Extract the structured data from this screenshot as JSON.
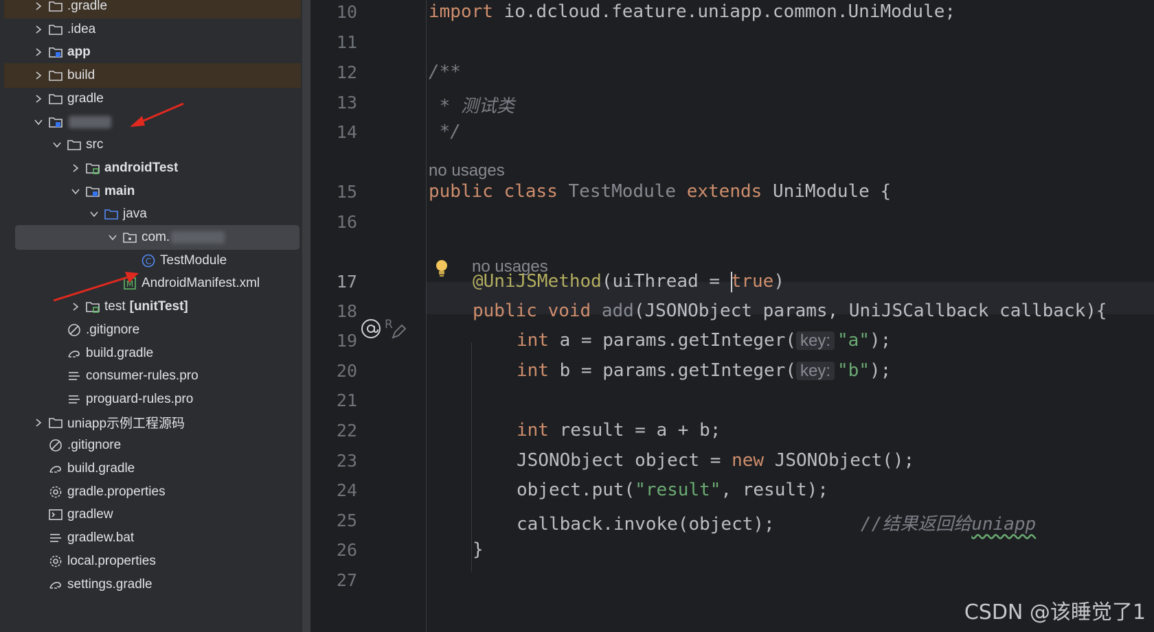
{
  "tree": {
    "items": [
      {
        "label": ".gradle",
        "icon": "folder-icon",
        "expand": "collapsed",
        "style": "excluded"
      },
      {
        "label": ".idea",
        "icon": "folder-icon",
        "expand": "collapsed"
      },
      {
        "label": "app",
        "icon": "module-folder-icon",
        "expand": "collapsed",
        "bold": true
      },
      {
        "label": "build",
        "icon": "folder-icon",
        "expand": "collapsed",
        "style": "excluded"
      },
      {
        "label": "gradle",
        "icon": "folder-icon",
        "expand": "collapsed"
      },
      {
        "label": "",
        "icon": "module-folder-icon",
        "expand": "expanded",
        "redacted": true
      },
      {
        "label": "src",
        "icon": "folder-icon",
        "expand": "expanded"
      },
      {
        "label": "androidTest",
        "icon": "test-folder-icon",
        "expand": "collapsed",
        "bold": true
      },
      {
        "label": "main",
        "icon": "module-folder-icon",
        "expand": "expanded",
        "bold": true
      },
      {
        "label": "java",
        "icon": "source-folder-icon",
        "expand": "expanded"
      },
      {
        "label": "com.",
        "icon": "package-icon",
        "expand": "expanded",
        "redacted": true,
        "selected": true
      },
      {
        "label": "TestModule",
        "icon": "java-class-icon",
        "expand": "none"
      },
      {
        "label": "AndroidManifest.xml",
        "icon": "manifest-icon",
        "expand": "none"
      },
      {
        "label": "test",
        "label_suffix": "[unitTest]",
        "icon": "test-folder-icon",
        "expand": "collapsed"
      },
      {
        "label": ".gitignore",
        "icon": "ignore-file-icon",
        "expand": "none"
      },
      {
        "label": "build.gradle",
        "icon": "gradle-icon",
        "expand": "none"
      },
      {
        "label": "consumer-rules.pro",
        "icon": "text-file-icon",
        "expand": "none"
      },
      {
        "label": "proguard-rules.pro",
        "icon": "text-file-icon",
        "expand": "none"
      },
      {
        "label": "uniapp示例工程源码",
        "icon": "folder-icon",
        "expand": "collapsed"
      },
      {
        "label": ".gitignore",
        "icon": "ignore-file-icon",
        "expand": "none"
      },
      {
        "label": "build.gradle",
        "icon": "gradle-icon",
        "expand": "none"
      },
      {
        "label": "gradle.properties",
        "icon": "settings-file-icon",
        "expand": "none"
      },
      {
        "label": "gradlew",
        "icon": "terminal-file-icon",
        "expand": "none"
      },
      {
        "label": "gradlew.bat",
        "icon": "text-file-icon",
        "expand": "none"
      },
      {
        "label": "local.properties",
        "icon": "settings-file-icon",
        "expand": "none"
      },
      {
        "label": "settings.gradle",
        "icon": "gradle-icon",
        "expand": "none"
      }
    ]
  },
  "editor": {
    "current_line": "17",
    "lines": [
      {
        "n": "10",
        "tokens": [
          [
            "kw",
            "import"
          ],
          [
            "",
            "io.dcloud.feature.uniapp.common.UniModule;"
          ]
        ]
      },
      {
        "n": "11",
        "tokens": []
      },
      {
        "n": "12",
        "tokens": [
          [
            "cm",
            "/**"
          ]
        ]
      },
      {
        "n": "13",
        "tokens": [
          [
            "cm",
            " * 测试类"
          ]
        ]
      },
      {
        "n": "14",
        "tokens": [
          [
            "cm",
            " */"
          ]
        ]
      },
      {
        "n": "15",
        "tokens": [
          [
            "kw",
            "public"
          ],
          [
            "kw",
            "class"
          ],
          [
            "unused",
            "TestModule"
          ],
          [
            "kw",
            "extends"
          ],
          [
            "",
            "UniModule {"
          ]
        ]
      },
      {
        "n": "16",
        "tokens": []
      },
      {
        "n": "17",
        "tokens": [
          [
            "ann",
            "@UniJSMethod"
          ],
          [
            "",
            "(uiThread = "
          ],
          [
            "cursor",
            ""
          ],
          [
            "kw",
            "true"
          ],
          [
            "",
            ")"
          ]
        ]
      },
      {
        "n": "18",
        "tokens": [
          [
            "kw",
            "public"
          ],
          [
            "kw",
            "void"
          ],
          [
            "unused",
            "add"
          ],
          [
            "",
            "(JSONObject params, UniJSCallback callback){"
          ]
        ]
      },
      {
        "n": "19",
        "tokens": [
          [
            "kw",
            "int"
          ],
          [
            "",
            "a = params.getInteger("
          ],
          [
            "inlay",
            "key:"
          ],
          [
            "str",
            "\"a\""
          ],
          [
            "",
            ");"
          ]
        ]
      },
      {
        "n": "20",
        "tokens": [
          [
            "kw",
            "int"
          ],
          [
            "",
            "b = params.getInteger("
          ],
          [
            "inlay",
            "key:"
          ],
          [
            "str",
            "\"b\""
          ],
          [
            "",
            ");"
          ]
        ]
      },
      {
        "n": "21",
        "tokens": []
      },
      {
        "n": "22",
        "tokens": [
          [
            "kw",
            "int"
          ],
          [
            "",
            "result = a + b;"
          ]
        ]
      },
      {
        "n": "23",
        "tokens": [
          [
            "",
            "JSONObject object = "
          ],
          [
            "kw",
            "new"
          ],
          [
            "",
            "JSONObject();"
          ]
        ]
      },
      {
        "n": "24",
        "tokens": [
          [
            "",
            "object.put("
          ],
          [
            "str",
            "\"result\""
          ],
          [
            "",
            ", result);"
          ]
        ]
      },
      {
        "n": "25",
        "tokens": [
          [
            "",
            "callback.invoke(object);"
          ],
          [
            "cm",
            "//结果返回给"
          ],
          [
            "cmwavy",
            "uniapp"
          ]
        ]
      },
      {
        "n": "26",
        "tokens": [
          [
            "",
            "}"
          ]
        ]
      },
      {
        "n": "27",
        "tokens": []
      }
    ],
    "usage_hints": [
      "no usages",
      "no usages"
    ],
    "gutter_icons": [
      "implementation-at-icon",
      "edit-rule-icon",
      "bulb-icon"
    ]
  },
  "watermark": "CSDN @该睡觉了1",
  "colors": {
    "keyword": "#cf8e6d",
    "annotation": "#b3ae60",
    "string": "#6aab73",
    "comment": "#7a7e85",
    "arrow": "#e0291f"
  }
}
